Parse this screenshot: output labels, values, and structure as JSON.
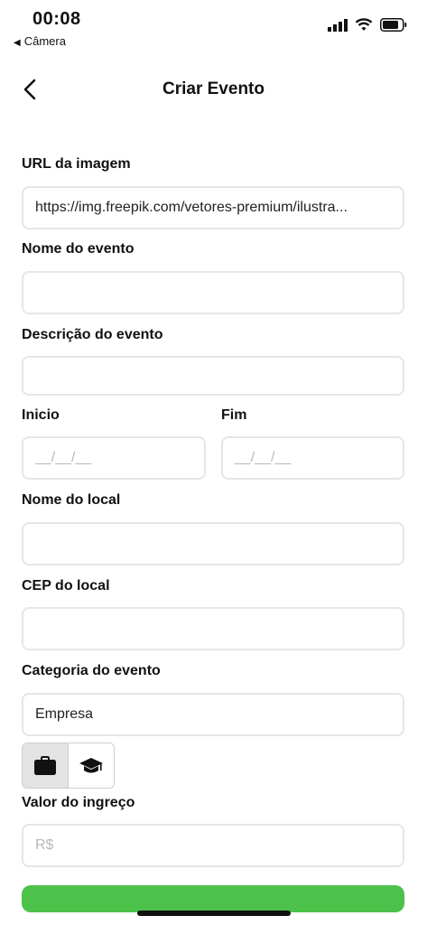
{
  "status": {
    "time": "00:08",
    "back_app": "Câmera"
  },
  "nav": {
    "title": "Criar Evento"
  },
  "form": {
    "image_url": {
      "label": "URL da imagem",
      "value": "https://img.freepik.com/vetores-premium/ilustra..."
    },
    "event_name": {
      "label": "Nome do evento",
      "value": ""
    },
    "event_description": {
      "label": "Descrição do evento",
      "value": ""
    },
    "start": {
      "label": "Inicio",
      "placeholder": "__/__/__"
    },
    "end": {
      "label": "Fim",
      "placeholder": "__/__/__"
    },
    "venue_name": {
      "label": "Nome do local",
      "value": ""
    },
    "venue_cep": {
      "label": "CEP do local",
      "value": ""
    },
    "category": {
      "label": "Categoria do evento",
      "value": "Empresa",
      "options": [
        {
          "icon": "briefcase-icon",
          "selected": true
        },
        {
          "icon": "graduation-cap-icon",
          "selected": false
        }
      ]
    },
    "ticket_price": {
      "label": "Valor do ingreço",
      "placeholder": "R$"
    }
  },
  "colors": {
    "submit": "#4cc24a",
    "border": "#e6e6e6",
    "selected_bg": "#e3e3e3"
  }
}
